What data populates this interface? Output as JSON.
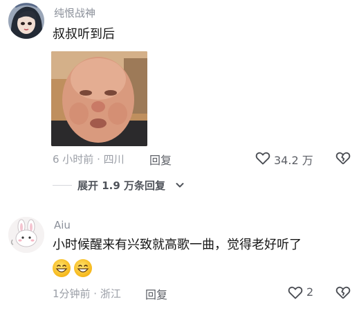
{
  "comments": [
    {
      "username": "纯恨战神",
      "text": "叔叔听到后",
      "time_location": "6 小时前 · 四川",
      "reply_label": "回复",
      "likes": "34.2 万",
      "expand_replies": "展开 1.9 万条回复",
      "avatar_icon": "anime-girl-avatar",
      "sticker_icon": "bald-man-pouting-sticker"
    },
    {
      "username": "Aiu",
      "text": "小时候醒来有兴致就高歌一曲，觉得老好听了",
      "emojis": [
        "grinning-face-emoji",
        "grinning-face-emoji"
      ],
      "time_location": "1分钟前 · 浙江",
      "reply_label": "回复",
      "likes": "2",
      "avatar_icon": "cartoon-bunny-avatar"
    }
  ],
  "colors": {
    "username": "#8a8f99",
    "text": "#151515",
    "meta": "#9a9ea6",
    "icon": "#4a4d53"
  }
}
